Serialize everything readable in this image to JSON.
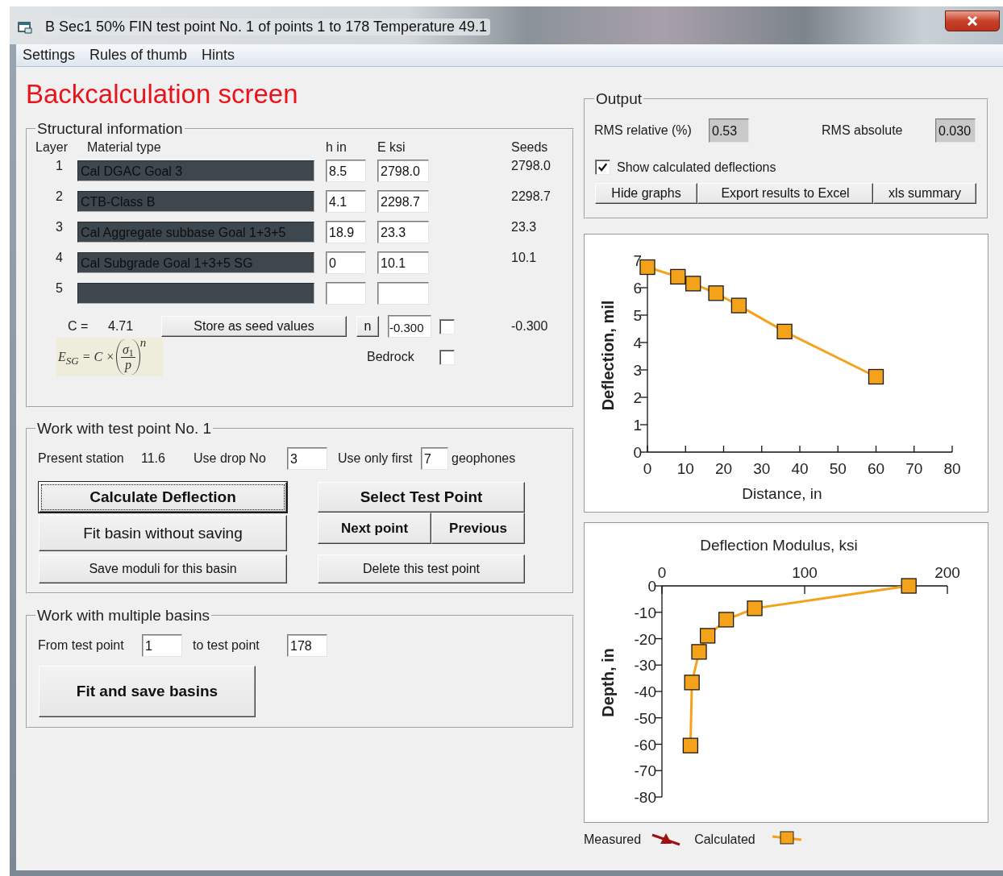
{
  "window": {
    "title": "B  Sec1 50% FIN test point No. 1 of points 1 to 178 Temperature 49.1"
  },
  "menu": [
    "Settings",
    "Rules of thumb",
    "Hints"
  ],
  "heading": "Backcalculation screen",
  "structural": {
    "title": "Structural information",
    "columns": [
      "Layer",
      "Material type",
      "h in",
      "E ksi",
      "Seeds"
    ],
    "layers": [
      {
        "number": "1",
        "material": "Cal DGAC Goal 3",
        "h": "8.5",
        "e": "2798.0",
        "seed": "2798.0"
      },
      {
        "number": "2",
        "material": "CTB-Class B",
        "h": "4.1",
        "e": "2298.7",
        "seed": "2298.7"
      },
      {
        "number": "3",
        "material": "Cal Aggregate subbase Goal 1+3+5",
        "h": "18.9",
        "e": "23.3",
        "seed": "23.3"
      },
      {
        "number": "4",
        "material": "Cal Subgrade Goal 1+3+5 SG",
        "h": "0",
        "e": "10.1",
        "seed": "10.1"
      },
      {
        "number": "5"
      }
    ],
    "c_label": "C =",
    "c_value": "4.71",
    "store_button": "Store as seed values",
    "n_button": "n",
    "n_value": "-0.300",
    "n_checked": false,
    "n_seed": "-0.300",
    "formula": {
      "lhs": "E",
      "lhs_sub": "SG",
      "mid": "= C ×",
      "numerator": "σ",
      "numerator_sub": "1",
      "denominator": "p",
      "exponent": "n"
    },
    "bedrock": {
      "label": "Bedrock",
      "checked": false
    }
  },
  "test_point": {
    "title": "Work with test point No. 1",
    "station_label": "Present station",
    "station": "11.6",
    "drop_label": "Use drop No",
    "drop": "3",
    "first_label": "Use only first",
    "first": "7",
    "geophones_label": "geophones",
    "buttons": [
      {
        "label": "Calculate Deflection",
        "kind": "major",
        "focused": true
      },
      {
        "label": "Select Test Point",
        "kind": "major",
        "focused": false
      },
      {
        "label": "Fit basin without saving",
        "kind": "large",
        "focused": false
      },
      {
        "label": "Next point",
        "kind": "bold",
        "focused": false
      },
      {
        "label": "Previous",
        "kind": "bold",
        "focused": false
      },
      {
        "label": "Save moduli for this basin",
        "kind": "plain",
        "focused": false
      },
      {
        "label": "Delete this test point",
        "kind": "plain",
        "focused": false
      }
    ]
  },
  "multiple": {
    "title": "Work with multiple basins",
    "from_label": "From test point",
    "from": "1",
    "to_label": "to test point",
    "to": "178",
    "button": "Fit and save basins"
  },
  "output": {
    "title": "Output",
    "rms_relative_label": "RMS relative (%)",
    "rms_relative": "0.53",
    "rms_absolute_label": "RMS absolute",
    "rms_absolute": "0.030",
    "show_calculated": {
      "label": "Show calculated deflections",
      "checked": true
    },
    "buttons": [
      "Hide graphs",
      "Export results to Excel",
      "xls summary"
    ]
  },
  "deflection_chart": {
    "chart_data": {
      "type": "line",
      "xlabel": "Distance, in",
      "ylabel": "Deflection, mil",
      "x": [
        0,
        8,
        12,
        18,
        24,
        36,
        60
      ],
      "series": [
        {
          "color": "#f5a21b",
          "marker": "square",
          "values": [
            6.75,
            6.4,
            6.15,
            5.8,
            5.35,
            4.4,
            2.75
          ]
        }
      ],
      "xlim": [
        0,
        80
      ],
      "ylim": [
        0,
        7
      ],
      "xticks": [
        0,
        10,
        20,
        30,
        40,
        50,
        60,
        70,
        80
      ],
      "yticks": [
        0,
        1,
        2,
        3,
        4,
        5,
        6,
        7
      ]
    }
  },
  "modulus_chart": {
    "chart_data": {
      "type": "line",
      "title": "Deflection Modulus, ksi",
      "ylabel": "Depth, in",
      "x": [
        173,
        65,
        45,
        32,
        26,
        21,
        20
      ],
      "series": [
        {
          "color": "#f5a21b",
          "marker": "square",
          "values": [
            0,
            -8.5,
            -12.8,
            -18.9,
            -25,
            -36.6,
            -60.5
          ]
        }
      ],
      "xlim": [
        0,
        200
      ],
      "ylim": [
        -80,
        0
      ],
      "xticks": [
        0,
        100,
        200
      ],
      "yticks": [
        0,
        -10,
        -20,
        -30,
        -40,
        -50,
        -60,
        -70,
        -80
      ]
    }
  },
  "legend": [
    {
      "label": "Measured",
      "color": "#a01010",
      "kind": "triangle"
    },
    {
      "label": "Calculated",
      "color": "#f5a21b",
      "kind": "square"
    }
  ]
}
